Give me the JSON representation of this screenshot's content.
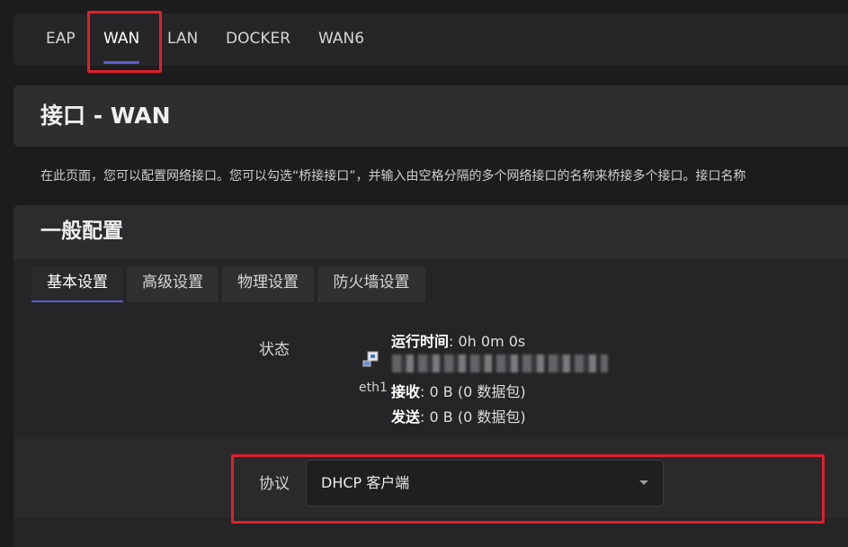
{
  "top_tabs": [
    {
      "label": "EAP",
      "active": false
    },
    {
      "label": "WAN",
      "active": true
    },
    {
      "label": "LAN",
      "active": false
    },
    {
      "label": "DOCKER",
      "active": false
    },
    {
      "label": "WAN6",
      "active": false
    }
  ],
  "page_title": "接口 - WAN",
  "description": "在此页面，您可以配置网络接口。您可以勾选“桥接接口”，并输入由空格分隔的多个网络接口的名称来桥接多个接口。接口名称",
  "section": {
    "title": "一般配置",
    "sub_tabs": [
      {
        "label": "基本设置",
        "active": true
      },
      {
        "label": "高级设置",
        "active": false
      },
      {
        "label": "物理设置",
        "active": false
      },
      {
        "label": "防火墙设置",
        "active": false
      }
    ]
  },
  "status": {
    "label": "状态",
    "interface": "eth1",
    "uptime_label": "运行时间",
    "uptime_value": ": 0h 0m 0s",
    "rx_label": "接收",
    "rx_value": ": 0 B (0 数据包)",
    "tx_label": "发送",
    "tx_value": ": 0 B (0 数据包)",
    "icon": "network-port-icon"
  },
  "protocol": {
    "label": "协议",
    "selected": "DHCP 客户端"
  },
  "colors": {
    "accent": "#5b5bd6",
    "highlight": "#e0202a"
  }
}
